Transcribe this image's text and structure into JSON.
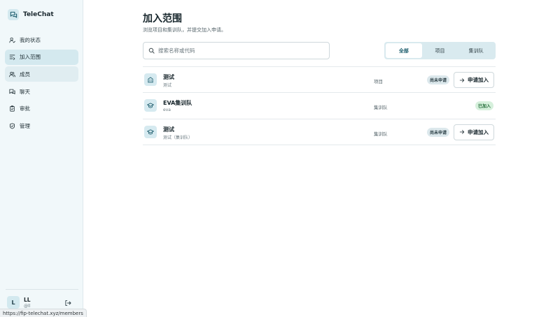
{
  "app": {
    "name": "TeleChat"
  },
  "sidebar": {
    "items": [
      {
        "label": "我的状态",
        "icon": "user-check-icon"
      },
      {
        "label": "加入范围",
        "icon": "list-join-icon"
      },
      {
        "label": "成员",
        "icon": "users-icon"
      },
      {
        "label": "聊天",
        "icon": "chat-icon"
      },
      {
        "label": "审批",
        "icon": "clipboard-check-icon"
      },
      {
        "label": "管理",
        "icon": "shield-check-icon"
      }
    ],
    "active_index": 1,
    "hover_index": 2
  },
  "user": {
    "initial": "L",
    "name": "LL",
    "handle": "@ll"
  },
  "page": {
    "title": "加入范围",
    "subtitle": "浏览项目和集训队，并提交加入申请。"
  },
  "search": {
    "placeholder": "搜索名称或代码",
    "value": ""
  },
  "filter_tabs": [
    "全部",
    "项目",
    "集训队"
  ],
  "filter_active_index": 0,
  "rows": [
    {
      "icon": "building-icon",
      "name": "测试",
      "code": "测试",
      "type": "项目",
      "status": "尚未申请",
      "action": "申请加入"
    },
    {
      "icon": "graduation-cap-icon",
      "name": "EVA集训队",
      "code": "eva",
      "type": "集训队",
      "status": "已加入",
      "action": ""
    },
    {
      "icon": "graduation-cap-icon",
      "name": "测试",
      "code": "测试（集训队）",
      "type": "集训队",
      "status": "尚未申请",
      "action": "申请加入"
    }
  ],
  "status_bar": {
    "url": "https://fip-telechat.xyz/members"
  },
  "colors": {
    "accent": "#1a5c6c",
    "active_nav": "#d4e9ef",
    "sidebar_bg": "#f1f8fa",
    "joined_badge": "#d6f0dc"
  }
}
